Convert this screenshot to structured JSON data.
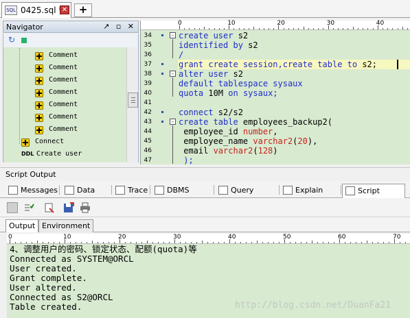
{
  "doc_tab": {
    "icon_text": "SQL",
    "title": "0425.sql *",
    "close": "✕",
    "add": "+"
  },
  "navigator": {
    "title": "Navigator",
    "buttons": "↗ ▫ ✕",
    "tree": [
      {
        "label": "Comment",
        "kind": "op"
      },
      {
        "label": "Comment",
        "kind": "op"
      },
      {
        "label": "Comment",
        "kind": "op"
      },
      {
        "label": "Comment",
        "kind": "op"
      },
      {
        "label": "Comment",
        "kind": "op"
      },
      {
        "label": "Comment",
        "kind": "op"
      },
      {
        "label": "Comment",
        "kind": "op"
      },
      {
        "label": "Connect",
        "kind": "op"
      },
      {
        "label": "Create user",
        "kind": "ddl",
        "badge": "DDL"
      }
    ]
  },
  "editor": {
    "ruler": [
      "0",
      "10",
      "20",
      "30",
      "40"
    ],
    "lines": [
      {
        "n": "34",
        "marker": true,
        "fold": "-",
        "segs": [
          [
            "kw",
            "create user "
          ],
          [
            "pl",
            "s2"
          ]
        ]
      },
      {
        "n": "35",
        "marker": false,
        "fold": "",
        "segs": [
          [
            "kw",
            "identified by "
          ],
          [
            "pl",
            "s2"
          ]
        ]
      },
      {
        "n": "36",
        "marker": false,
        "fold": "",
        "segs": [
          [
            "kw",
            "/"
          ]
        ]
      },
      {
        "n": "37",
        "marker": true,
        "fold": "",
        "segs": [
          [
            "kw",
            "grant create session,create table to "
          ],
          [
            "pl",
            "s2;"
          ]
        ],
        "current": true
      },
      {
        "n": "38",
        "marker": true,
        "fold": "-",
        "segs": [
          [
            "kw",
            "alter user "
          ],
          [
            "pl",
            "s2"
          ]
        ]
      },
      {
        "n": "39",
        "marker": false,
        "fold": "",
        "segs": [
          [
            "kw",
            "default tablespace sysaux"
          ]
        ]
      },
      {
        "n": "40",
        "marker": false,
        "fold": "",
        "segs": [
          [
            "kw",
            "quota "
          ],
          [
            "pl",
            "10M "
          ],
          [
            "kw",
            "on sysaux;"
          ]
        ]
      },
      {
        "n": "41",
        "marker": false,
        "fold": "",
        "segs": []
      },
      {
        "n": "42",
        "marker": true,
        "fold": "",
        "segs": [
          [
            "kw",
            "connect "
          ],
          [
            "pl",
            "s2/s2"
          ]
        ]
      },
      {
        "n": "43",
        "marker": true,
        "fold": "-",
        "segs": [
          [
            "kw",
            "create table "
          ],
          [
            "pl",
            "employees_backup2("
          ]
        ]
      },
      {
        "n": "44",
        "marker": false,
        "fold": "",
        "segs": [
          [
            "pl",
            " employee_id "
          ],
          [
            "ty",
            "number"
          ],
          [
            "pl",
            ","
          ]
        ]
      },
      {
        "n": "45",
        "marker": false,
        "fold": "",
        "segs": [
          [
            "pl",
            " employee_name "
          ],
          [
            "ty",
            "varchar2"
          ],
          [
            "pl",
            "("
          ],
          [
            "ty",
            "20"
          ],
          [
            "pl",
            "),"
          ]
        ]
      },
      {
        "n": "46",
        "marker": false,
        "fold": "",
        "segs": [
          [
            "pl",
            " email "
          ],
          [
            "ty",
            "varchar2"
          ],
          [
            "pl",
            "("
          ],
          [
            "ty",
            "128"
          ],
          [
            "pl",
            ")"
          ]
        ]
      },
      {
        "n": "47",
        "marker": false,
        "fold": "",
        "segs": [
          [
            "kw",
            " );"
          ]
        ]
      }
    ]
  },
  "script_output": {
    "title": "Script Output",
    "tabs": [
      "Messages",
      "Data Grid",
      "Trace",
      "DBMS Output",
      "Query Viewer",
      "Explain Plan",
      "Script Output"
    ],
    "active_tab": "Script Output",
    "sub_tabs": [
      "Output",
      "Environment"
    ],
    "ruler": [
      "0",
      "10",
      "20",
      "30",
      "40",
      "50",
      "60",
      "70"
    ],
    "lines": [
      "4、调整用户的密码、锁定状态、配额(quota)等",
      "Connected as SYSTEM@ORCL",
      "User created.",
      "Grant complete.",
      "User altered.",
      "Connected as S2@ORCL",
      "Table created."
    ],
    "watermark": "http://blog.csdn.net/DuanFa21"
  }
}
